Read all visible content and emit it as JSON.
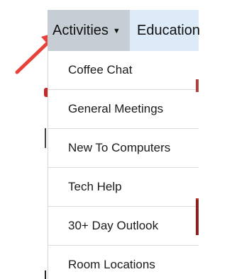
{
  "navbar": {
    "active_item": "Activities",
    "next_item": "Education"
  },
  "dropdown": {
    "items": [
      "Coffee Chat",
      "General Meetings",
      "New To Computers",
      "Tech Help",
      "30+ Day Outlook",
      "Room Locations"
    ]
  },
  "colors": {
    "navbar_bg": "#ddeaf8",
    "active_bg": "#c6cdd4",
    "arrow": "#e8413a"
  },
  "icons": {
    "caret": "caret-down-icon",
    "pointer": "red-arrow-icon"
  }
}
